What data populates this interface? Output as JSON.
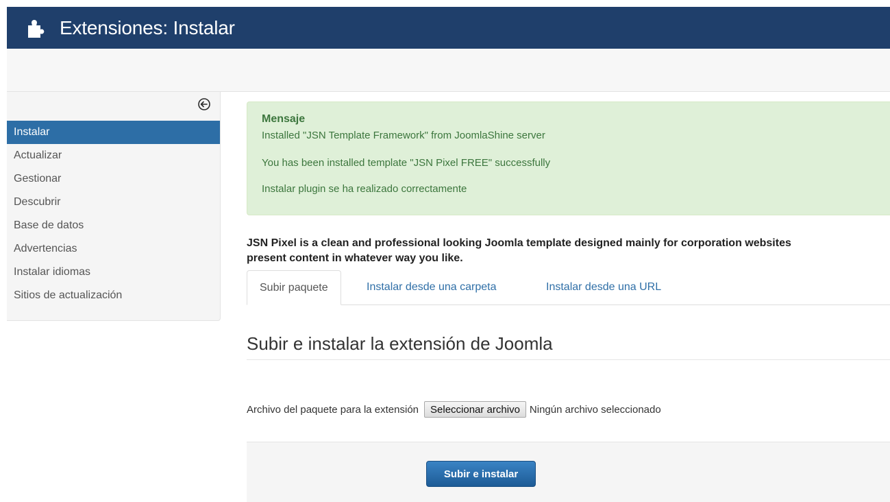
{
  "header": {
    "title": "Extensiones: Instalar",
    "icon": "puzzle-icon",
    "background": "#1f3f6b"
  },
  "sidebar": {
    "collapse_icon": "arrow-left-circle-icon",
    "items": [
      {
        "label": "Instalar",
        "active": true
      },
      {
        "label": "Actualizar"
      },
      {
        "label": "Gestionar"
      },
      {
        "label": "Descubrir"
      },
      {
        "label": "Base de datos"
      },
      {
        "label": "Advertencias"
      },
      {
        "label": "Instalar idiomas"
      },
      {
        "label": "Sitios de actualización"
      }
    ]
  },
  "alert": {
    "heading": "Mensaje",
    "messages": [
      "Installed \"JSN Template Framework\" from JoomlaShine server",
      "You has been installed template \"JSN Pixel FREE\" successfully",
      "Instalar plugin se ha realizado correctamente"
    ],
    "color": "#dff0d8"
  },
  "description": {
    "line1": "JSN Pixel is a clean and professional looking Joomla template designed mainly for corporation websites",
    "line2": "present content in whatever way you like."
  },
  "tabs": [
    {
      "label": "Subir paquete",
      "active": true
    },
    {
      "label": "Instalar desde una carpeta"
    },
    {
      "label": "Instalar desde una URL"
    }
  ],
  "upload": {
    "section_title": "Subir e instalar la extensión de Joomla",
    "file_label": "Archivo del paquete para la extensión",
    "file_button": "Seleccionar archivo",
    "file_status": "Ningún archivo seleccionado",
    "submit_label": "Subir e instalar",
    "accent": "#2d6ea6"
  }
}
